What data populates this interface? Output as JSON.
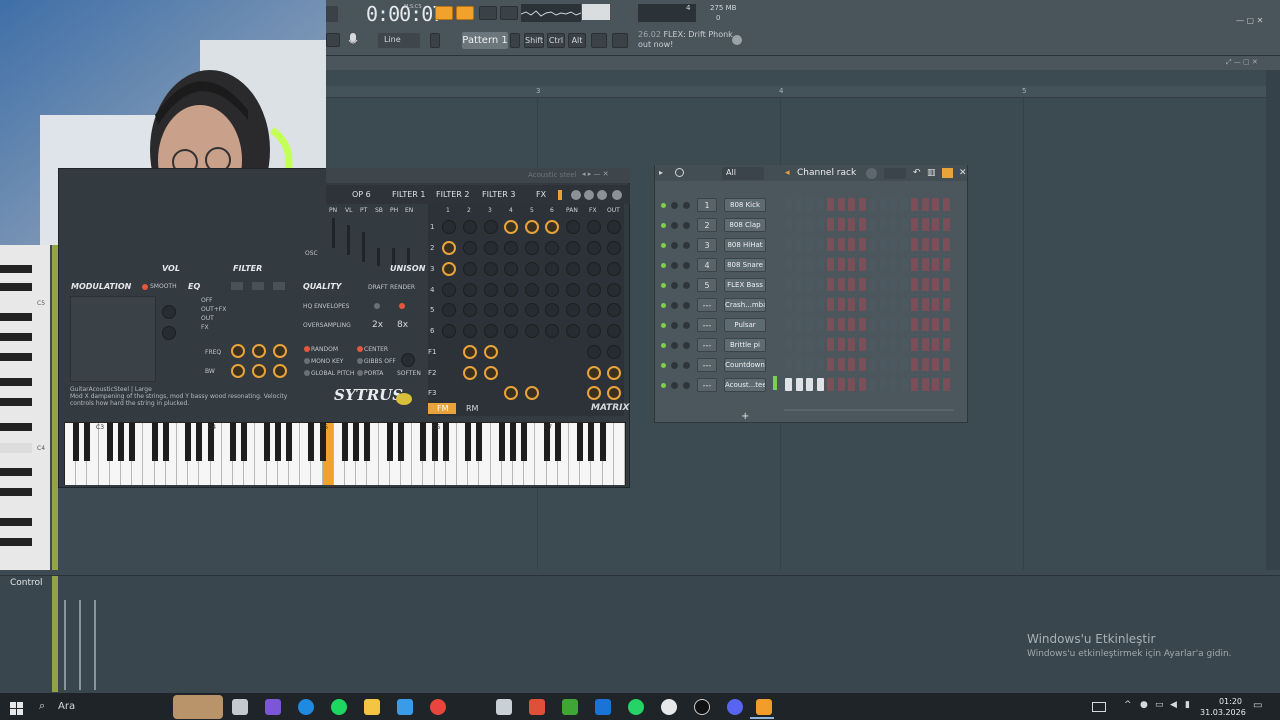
{
  "toolbar": {
    "time": "0:00:07",
    "time_unit": "M:S:CS",
    "memory": "275 MB",
    "cpu": "4",
    "voices": "0",
    "snap": "Line",
    "pattern": "Pattern 1",
    "keys": [
      "Shift",
      "Ctrl",
      "Alt"
    ],
    "news_date": "26.02",
    "news_text": "FLEX: Drift Phonk out now!"
  },
  "playlist": {
    "bars": [
      "3",
      "4",
      "5"
    ]
  },
  "plugin": {
    "title": "Acoustic steel",
    "tabs": [
      "OP 6",
      "FILTER 1",
      "FILTER 2",
      "FILTER 3",
      "FX"
    ],
    "op_labels": [
      "PN",
      "VL",
      "PT",
      "SB",
      "PH",
      "EN"
    ],
    "matrix_cols": [
      "1",
      "2",
      "3",
      "4",
      "5",
      "6",
      "PAN",
      "FX",
      "OUT"
    ],
    "matrix_rows": [
      "1",
      "2",
      "3",
      "4",
      "5",
      "6",
      "F1",
      "F2",
      "F3"
    ],
    "osc_label": "OSC",
    "vol_label": "VOL",
    "filter_label": "FILTER",
    "unison_label": "UNISON",
    "modulation_title": "MODULATION",
    "smooth_label": "SMOOTH",
    "eq_title": "EQ",
    "eq_labels": [
      "OFF",
      "OUT+FX",
      "OUT",
      "FX"
    ],
    "freq_label": "FREQ",
    "bw_label": "BW",
    "quality_title": "QUALITY",
    "draft_label": "DRAFT",
    "render_label": "RENDER",
    "hq_env_label": "HQ ENVELOPES",
    "oversampling_label": "OVERSAMPLING",
    "os_2x": "2x",
    "os_8x": "8x",
    "pitch_opts": [
      "RANDOM",
      "CENTER",
      "MONO KEY",
      "GIBBS OFF",
      "GLOBAL PITCH",
      "PORTA",
      "SOFTEN"
    ],
    "desc_title": "GuitarAcousticSteel",
    "desc_size": "| Large",
    "desc_body": "Mod X dampening of the strings, mod Y bassy wood resonating. Velocity controls how hard the string in plucked.",
    "logo": "SYTRUS",
    "fm_label": "FM",
    "rm_label": "RM",
    "matrix_label": "MATRIX",
    "octaves": [
      "C3",
      "C4",
      "C5",
      "C6",
      "C7"
    ]
  },
  "left_keys": {
    "labels": [
      "C5",
      "C4"
    ]
  },
  "channel_rack": {
    "title": "Channel rack",
    "filter": "All",
    "channels": [
      {
        "num": "1",
        "name": "808 Kick"
      },
      {
        "num": "2",
        "name": "808 Clap"
      },
      {
        "num": "3",
        "name": "808 HiHat"
      },
      {
        "num": "4",
        "name": "808 Snare"
      },
      {
        "num": "5",
        "name": "FLEX Bass"
      },
      {
        "num": "---",
        "name": "Crash...mbal"
      },
      {
        "num": "---",
        "name": "Pulsar"
      },
      {
        "num": "---",
        "name": "Brittle pi"
      },
      {
        "num": "---",
        "name": "Countdown"
      },
      {
        "num": "---",
        "name": "Acoust...teel"
      }
    ],
    "add_label": "+"
  },
  "control": {
    "label": "Control"
  },
  "watermark": {
    "line1": "Windows'u Etkinleştir",
    "line2": "Windows'u etkinleştirmek için Ayarlar'a gidin."
  },
  "taskbar": {
    "search": "Ara",
    "time": "01:20",
    "date": "31.03.2026"
  },
  "colors": {
    "accent": "#f0a22c",
    "step_red": "#7a4f58",
    "led_green": "#7ed04a"
  }
}
